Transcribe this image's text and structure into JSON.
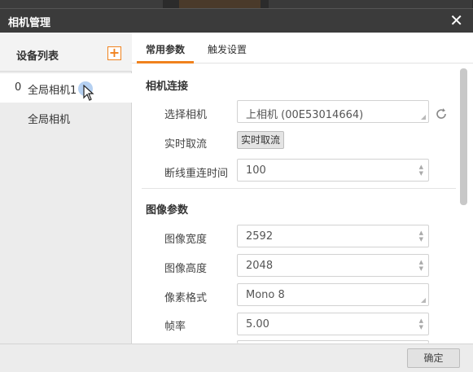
{
  "window": {
    "title": "相机管理",
    "close_glyph": "✕"
  },
  "sidebar": {
    "title": "设备列表",
    "add_glyph": "+",
    "devices": [
      {
        "index": "0",
        "name": "全局相机1"
      },
      {
        "index": "",
        "name": "全局相机"
      }
    ]
  },
  "tabs": [
    {
      "label": "常用参数"
    },
    {
      "label": "触发设置"
    }
  ],
  "sections": {
    "camera_connection": {
      "title": "相机连接",
      "select_camera": {
        "label": "选择相机",
        "value": "上相机 (00E53014664)"
      },
      "live_capture": {
        "label": "实时取流",
        "button": "实时取流"
      },
      "reconnect_time": {
        "label": "断线重连时间",
        "value": "100"
      }
    },
    "image_params": {
      "title": "图像参数",
      "width": {
        "label": "图像宽度",
        "value": "2592"
      },
      "height": {
        "label": "图像高度",
        "value": "2048"
      },
      "pixel_format": {
        "label": "像素格式",
        "value": "Mono 8"
      },
      "frame_rate": {
        "label": "帧率",
        "value": "5.00"
      }
    }
  },
  "footer": {
    "ok_label": "确定"
  },
  "icons": {
    "refresh": "refresh-icon",
    "close": "close-icon",
    "add": "add-icon",
    "cursor": "mouse-cursor-icon"
  },
  "colors": {
    "accent": "#f0821e",
    "titlebar": "#3b3b3b",
    "sidebar": "#ececec"
  }
}
